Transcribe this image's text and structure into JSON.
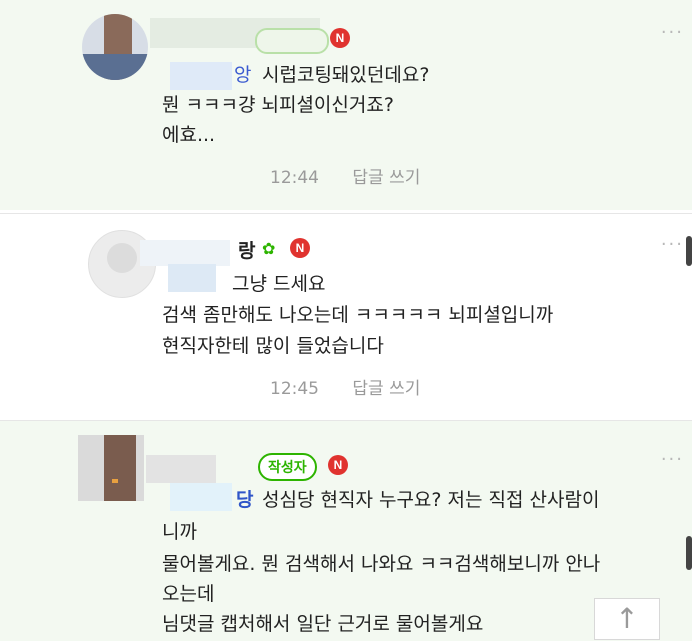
{
  "comments": [
    {
      "lines": [
        "시럽코팅돼있던데요?",
        "뭔 ㅋㅋㅋ걍 뇌피셜이신거죠?",
        "에효..."
      ],
      "nick_fragment": "앙",
      "time": "12:44",
      "reply_label": "답글 쓰기",
      "n_badge": "N",
      "more": "···"
    },
    {
      "nick_fragment": "랑",
      "lines": [
        "그냥 드세요",
        "검색 좀만해도 나오는데 ㅋㅋㅋㅋㅋ 뇌피셜입니까",
        "현직자한테 많이 들었습니다"
      ],
      "time": "12:45",
      "reply_label": "답글 쓰기",
      "n_badge": "N",
      "more": "···"
    },
    {
      "author_badge": "작성자",
      "n_badge": "N",
      "nick_fragment": "당",
      "lines": [
        "성심당 현직자 누구요? 저는 직접 산사람이",
        "니까",
        "물어볼게요. 뭔 검색해서 나와요 ㅋㅋ검색해보니까 안나",
        "오는데",
        "님댓글 캡처해서 일단 근거로 물어볼게요"
      ],
      "more": "···"
    }
  ],
  "scroll_top_icon": "arrow-up-icon",
  "colors": {
    "accent": "#2db400",
    "n_badge": "#e0332f",
    "highlight_bg": "#f3f9f1"
  }
}
